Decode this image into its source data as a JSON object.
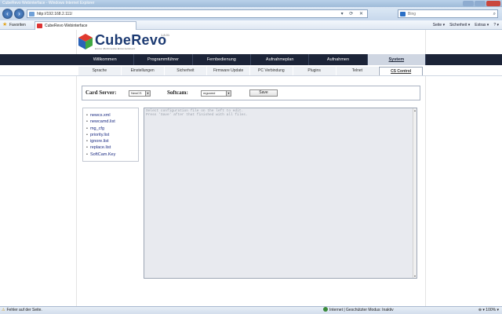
{
  "browser": {
    "title": "CubeRevo Webinterface - Windows Internet Explorer",
    "url": "http://192.168.2.111/",
    "search_placeholder": "Bing",
    "favorites_label": "Favoriten",
    "tab_title": "CubeRevo Webinterface",
    "commands": [
      "Seite ▾",
      "Sicherheit ▾",
      "Extras ▾",
      "? ▾"
    ],
    "status_left": "Fehler auf der Seite.",
    "status_zone": "Internet | Geschützter Modus: Inaktiv",
    "zoom": "100%"
  },
  "logo": {
    "text_cube": "Cube",
    "text_revo": "Revo",
    "tagline": "Home Multimedia Entertainment",
    "version": "1.8.01"
  },
  "main_nav": [
    "Willkommen",
    "Programmführer",
    "Fernbedienung",
    "Aufnahmeplan",
    "Aufnahmen",
    "System"
  ],
  "main_nav_active": "System",
  "sub_nav": [
    "Sprache",
    "Einstellungen",
    "Sicherheit",
    "Firmware Update",
    "PC Verbindung",
    "Plugins",
    "Telnet",
    "CS Control"
  ],
  "sub_nav_active": "CS Control",
  "cs_control": {
    "card_server_label": "Card Server:",
    "card_server_value": "NewCS",
    "softcam_label": "Softcam:",
    "softcam_value": "mgcamd",
    "save_label": "Save"
  },
  "files": [
    "newcs.xml",
    "newcamd.list",
    "mg_cfg",
    "priority.list",
    "ignore.list",
    "replace.list",
    "SoftCam.Key"
  ],
  "editor_placeholder": "Select configuration file on the left to edit.\nPress 'Save' after that finished with all files.",
  "colors": {
    "nav_bg": "#1c2438",
    "link": "#1b2b82",
    "logo": "#1c3a72"
  }
}
